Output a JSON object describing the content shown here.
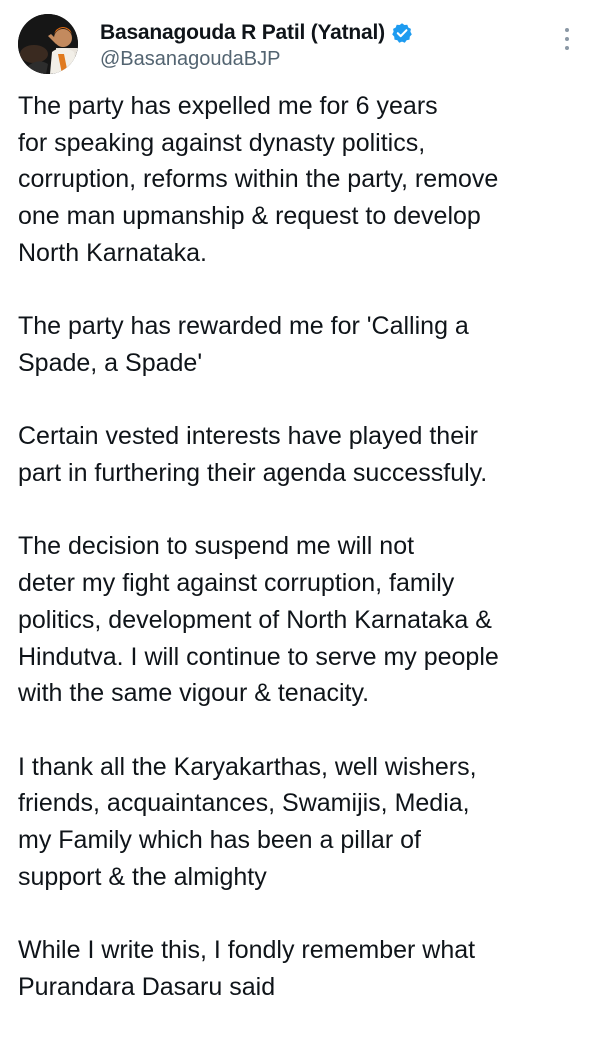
{
  "author": {
    "display_name": "Basanagouda R Patil (Yatnal)",
    "handle": "@BasanagoudaBJP",
    "verified_color": "#1d9bf0",
    "avatar_icon": "profile-photo"
  },
  "menu": {
    "icon": "more-vertical-icon"
  },
  "tweet": {
    "paragraphs": [
      "The party has expelled me for 6 years\nfor speaking against dynasty politics,\ncorruption, reforms within the party, remove\none man upmanship & request to develop\nNorth Karnataka.",
      " The party has rewarded me for 'Calling a\nSpade, a Spade'",
      "Certain vested interests have played their\npart in furthering their agenda successfuly.",
      "The decision to suspend me will not\ndeter my fight against corruption, family\npolitics, development of North Karnataka &\nHindutva. I will continue to serve my people\nwith the same vigour & tenacity.",
      "I thank all the Karyakarthas, well wishers,\nfriends, acquaintances, Swamijis, Media,\nmy Family which has been a pillar of\nsupport & the almighty",
      "While I write this, I fondly remember what\nPurandara Dasaru said"
    ]
  }
}
